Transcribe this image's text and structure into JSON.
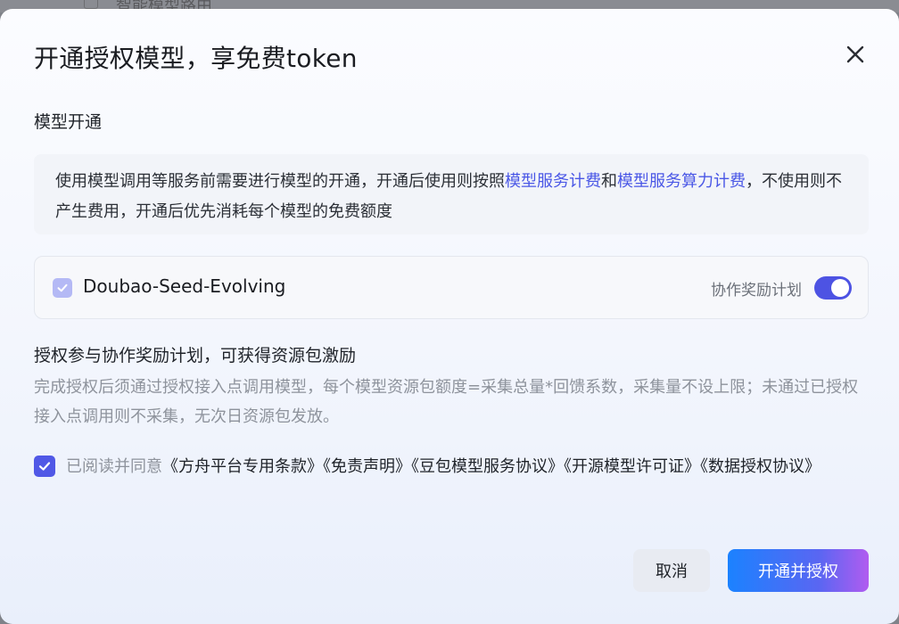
{
  "background": {
    "ghost_text": "智能模型路由"
  },
  "dialog": {
    "title": "开通授权模型，享免费token",
    "close_icon": "close-icon"
  },
  "activation": {
    "section_title": "模型开通",
    "info_part1": "使用模型调用等服务前需要进行模型的开通，开通后使用则按照",
    "info_link1": "模型服务计费",
    "info_and": "和",
    "info_link2": "模型服务算力计费",
    "info_part2": "，不使用则不产生费用，开通后优先消耗每个模型的免费额度"
  },
  "model": {
    "name": "Doubao-Seed-Evolving",
    "checked": true,
    "reward_label": "协作奖励计划",
    "reward_enabled": true
  },
  "reward": {
    "title": "授权参与协作奖励计划，可获得资源包激励",
    "desc": "完成授权后须通过授权接入点调用模型，每个模型资源包额度=采集总量*回馈系数，采集量不设上限；未通过已授权接入点调用则不采集，无次日资源包发放。"
  },
  "agreement": {
    "checked": true,
    "prefix": "已阅读并同意",
    "docs": [
      "《方舟平台专用条款》",
      "《免责声明》",
      "《豆包模型服务协议》",
      "《开源模型许可证》",
      "《数据授权协议》"
    ]
  },
  "footer": {
    "cancel_label": "取消",
    "confirm_label": "开通并授权"
  },
  "colors": {
    "accent": "#4d53e3",
    "link": "#4a57e6",
    "gradient_start": "#1b82ff",
    "gradient_end": "#b15cf0"
  }
}
